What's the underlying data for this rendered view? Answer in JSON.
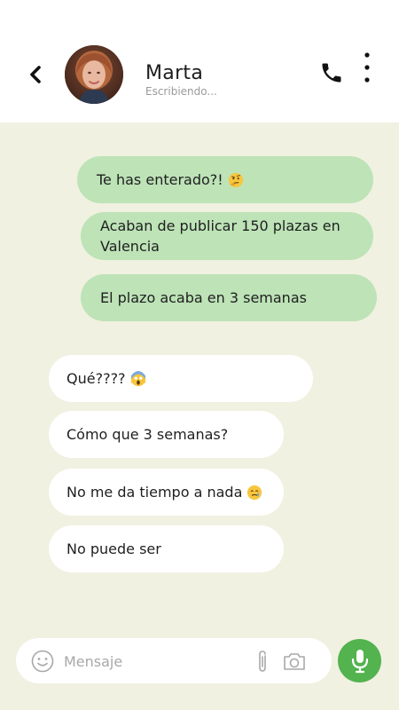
{
  "header": {
    "contact_name": "Marta",
    "status": "Escribiendo..."
  },
  "sent_messages": [
    {
      "text": "Te has enterado?!",
      "emoji": "thinking-face"
    },
    {
      "text": "Acaban de publicar 150 plazas en Valencia"
    },
    {
      "text": "El plazo acaba en 3 semanas"
    }
  ],
  "received_messages": [
    {
      "text": "Qué????",
      "emoji": "screaming-face"
    },
    {
      "text": "Cómo que 3 semanas?"
    },
    {
      "text": "No me da tiempo a nada",
      "emoji": "crying-face"
    },
    {
      "text": "No puede ser"
    }
  ],
  "input": {
    "placeholder": "Mensaje",
    "value": ""
  },
  "icons": {
    "back": "chevron-left-icon",
    "call": "phone-icon",
    "more": "more-vertical-icon",
    "emoji": "smiley-icon",
    "attach": "paperclip-icon",
    "camera": "camera-icon",
    "mic": "microphone-icon"
  },
  "colors": {
    "background": "#f0f1e1",
    "sent_bubble": "#bde3b7",
    "received_bubble": "#ffffff",
    "mic_button": "#53b34f"
  }
}
